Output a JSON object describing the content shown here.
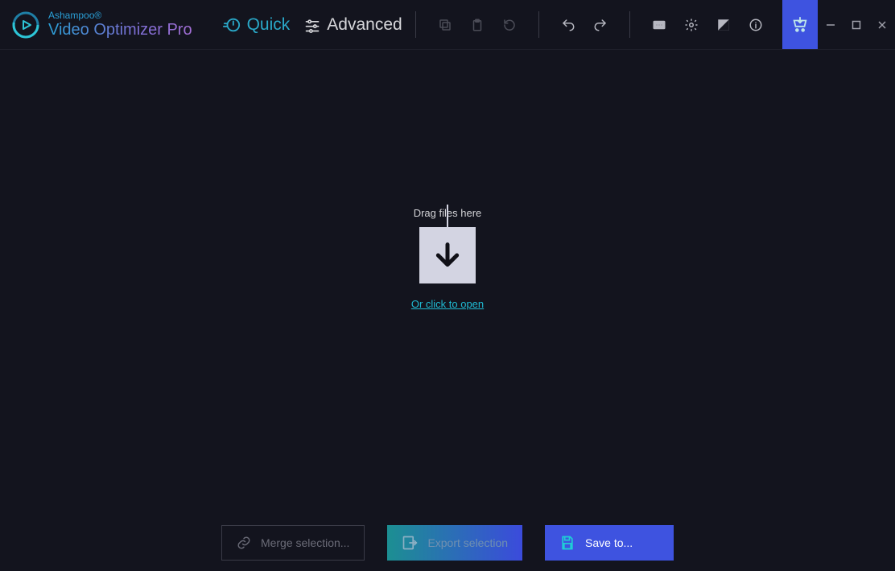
{
  "brand": {
    "line1": "Ashampoo®",
    "line2": "Video Optimizer Pro"
  },
  "modes": {
    "quick": "Quick",
    "advanced": "Advanced"
  },
  "drop": {
    "label": "Drag files here",
    "link": "Or click to open"
  },
  "buttons": {
    "merge": "Merge selection...",
    "export": "Export selection",
    "save": "Save to..."
  },
  "icons": {
    "copy": "copy",
    "paste": "paste",
    "reset": "reset",
    "undo": "undo",
    "redo": "redo",
    "subtitle": "subtitle",
    "settings": "settings",
    "contrast": "contrast",
    "info": "info",
    "cart": "cart"
  }
}
